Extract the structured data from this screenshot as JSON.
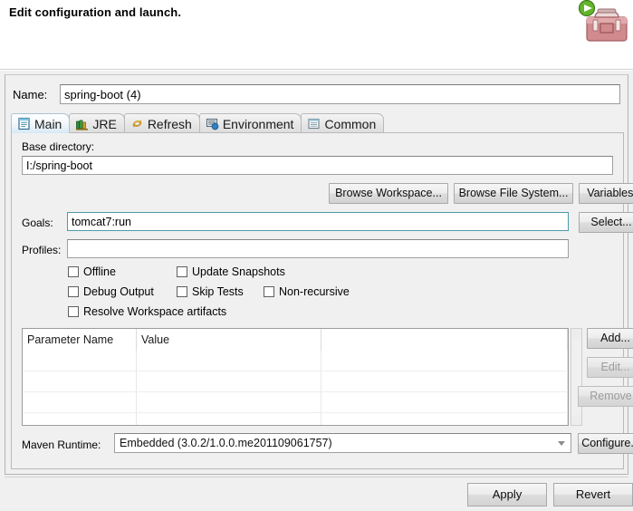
{
  "header": {
    "title": "Edit configuration and launch.",
    "icon": "run-toolbox-icon"
  },
  "name_field": {
    "label": "Name:",
    "value": "spring-boot (4)"
  },
  "tabs": [
    {
      "label": "Main",
      "icon": "main-document-icon",
      "selected": true
    },
    {
      "label": "JRE",
      "icon": "jre-books-icon",
      "selected": false
    },
    {
      "label": "Refresh",
      "icon": "refresh-arrows-icon",
      "selected": false
    },
    {
      "label": "Environment",
      "icon": "environment-icon",
      "selected": false
    },
    {
      "label": "Common",
      "icon": "common-list-icon",
      "selected": false
    }
  ],
  "main_tab": {
    "base_directory": {
      "label": "Base directory:",
      "value": "I:/spring-boot"
    },
    "browse_buttons": [
      "Browse Workspace...",
      "Browse File System...",
      "Variables..."
    ],
    "goals": {
      "label": "Goals:",
      "value": "tomcat7:run",
      "button": "Select..."
    },
    "profiles": {
      "label": "Profiles:",
      "value": "",
      "placeholder": ""
    },
    "checkboxes": [
      {
        "label": "Offline",
        "checked": false
      },
      {
        "label": "Update Snapshots",
        "checked": false
      },
      {
        "label": "Debug Output",
        "checked": false
      },
      {
        "label": "Skip Tests",
        "checked": false
      },
      {
        "label": "Non-recursive",
        "checked": false
      },
      {
        "label": "Resolve Workspace artifacts",
        "checked": false
      }
    ],
    "parameters_table": {
      "columns": [
        "Parameter Name",
        "Value",
        ""
      ],
      "rows": []
    },
    "table_buttons": [
      {
        "label": "Add...",
        "enabled": true
      },
      {
        "label": "Edit...",
        "enabled": false
      },
      {
        "label": "Remove",
        "enabled": false
      }
    ],
    "maven_runtime": {
      "label": "Maven Runtime:",
      "value": "Embedded (3.0.2/1.0.0.me201109061757)",
      "button": "Configure..."
    }
  },
  "footer": {
    "apply_label": "Apply",
    "revert_label": "Revert"
  },
  "colors": {
    "dialog_bg": "#f0f0f0",
    "focus_border": "#4c9aaa",
    "selected_tab": "#d7e8f5",
    "run_badge": "#4caf1e",
    "toolbox_red": "#c4696c"
  }
}
